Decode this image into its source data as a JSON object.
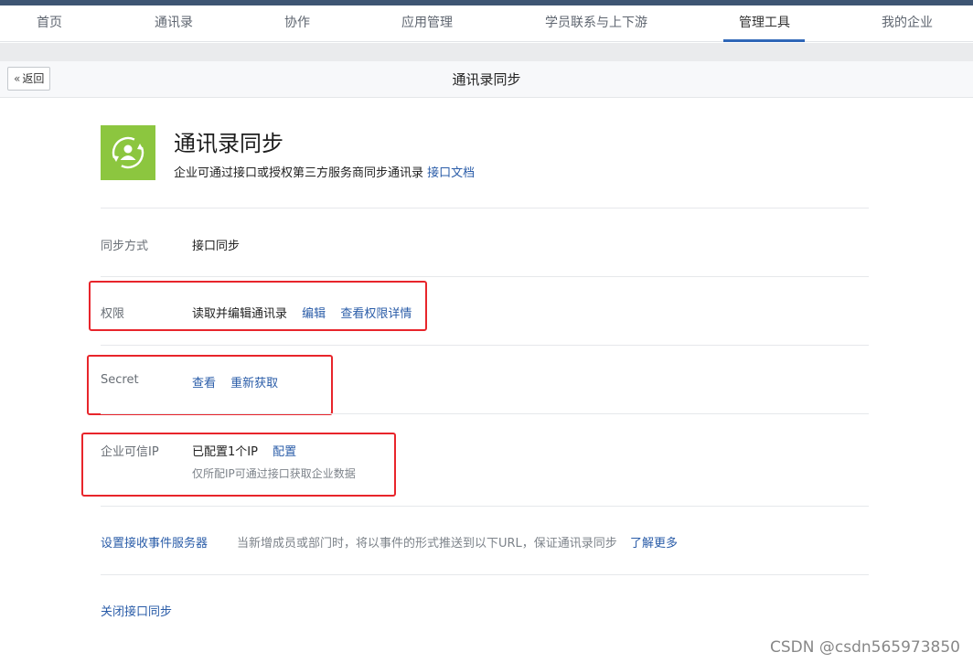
{
  "nav": {
    "items": [
      "首页",
      "通讯录",
      "协作",
      "应用管理",
      "学员联系与上下游",
      "管理工具",
      "我的企业"
    ],
    "active": "管理工具"
  },
  "subheader": {
    "back_label": "返回",
    "title": "通讯录同步"
  },
  "app": {
    "icon": "sync-contacts-icon",
    "title": "通讯录同步",
    "desc": "企业可通过接口或授权第三方服务商同步通讯录",
    "doc_link": "接口文档"
  },
  "rows": {
    "sync_method": {
      "label": "同步方式",
      "value": "接口同步"
    },
    "permission": {
      "label": "权限",
      "value": "读取并编辑通讯录",
      "edit": "编辑",
      "details": "查看权限详情"
    },
    "secret": {
      "label": "Secret",
      "view": "查看",
      "refetch": "重新获取"
    },
    "trusted_ip": {
      "label": "企业可信IP",
      "value": "已配置1个IP",
      "config": "配置",
      "hint": "仅所配IP可通过接口获取企业数据"
    }
  },
  "event_server": {
    "label": "设置接收事件服务器",
    "desc": "当新增成员或部门时，将以事件的形式推送到以下URL，保证通讯录同步",
    "more": "了解更多"
  },
  "close_sync": "关闭接口同步",
  "watermark": "CSDN @csdn565973850",
  "colors": {
    "accent": "#2a5ca8",
    "icon_green": "#8cc63f",
    "highlight_red": "#e8252b",
    "top_stripe": "#3e5573"
  }
}
